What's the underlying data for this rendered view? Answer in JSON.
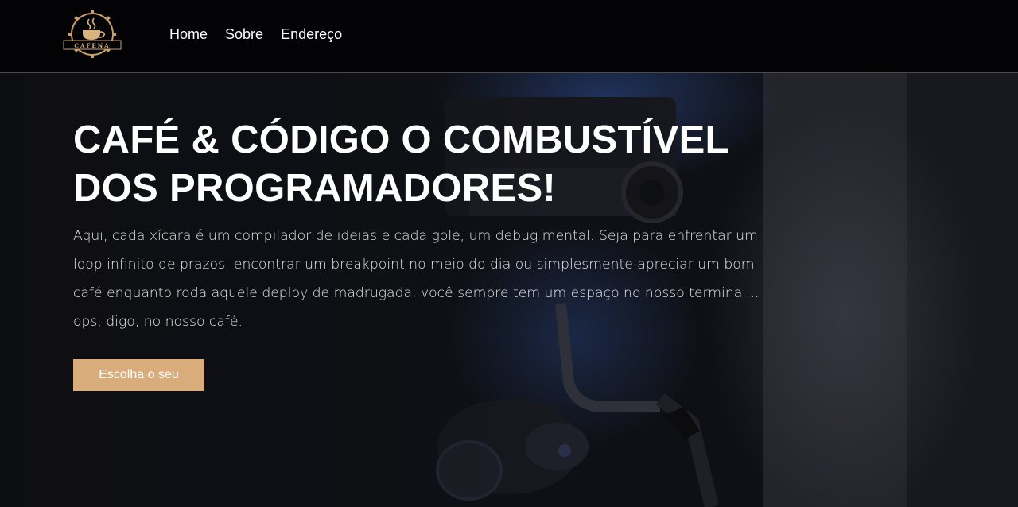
{
  "header": {
    "logo_text": "CAFENA",
    "nav": [
      {
        "label": "Home"
      },
      {
        "label": "Sobre"
      },
      {
        "label": "Endereço"
      }
    ]
  },
  "hero": {
    "title_line1": "CAFÉ & CÓDIGO O COMBUSTÍVEL",
    "title_line2": "DOS PROGRAMADORES!",
    "paragraph": "Aqui, cada xícara é um compilador de ideias e cada gole, um debug mental. Seja para enfrentar um loop infinito de prazos, encontrar um breakpoint no meio do dia ou simplesmente apreciar um bom café enquanto roda aquele deploy de madrugada, você sempre tem um espaço no nosso terminal... ops, digo, no nosso café.",
    "cta_label": "Escolha o seu"
  },
  "colors": {
    "header_bg": "#030305",
    "accent": "#d9ac7c",
    "hero_bg": "#0d0e12"
  },
  "icons": {
    "logo": "coffee-cup-gear-logo"
  }
}
